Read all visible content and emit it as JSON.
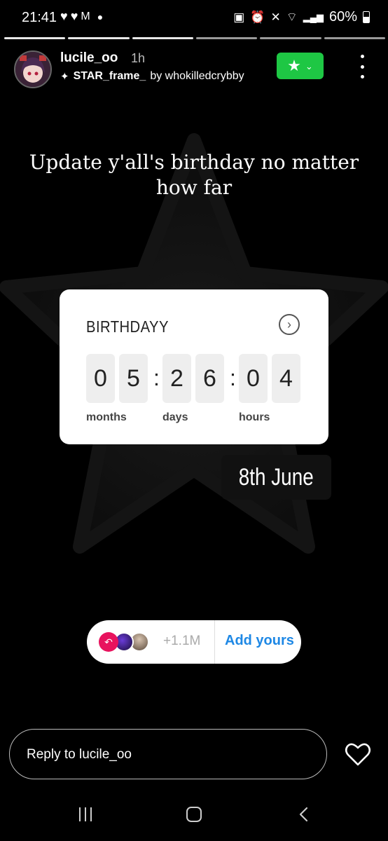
{
  "status_bar": {
    "time": "21:41",
    "left_icons": [
      "heart-icon",
      "heart-icon",
      "gmail-icon",
      "dot-icon"
    ],
    "right_icons": [
      "battery-saver-icon",
      "alarm-icon",
      "mute-icon",
      "wifi-icon",
      "signal-icon"
    ],
    "battery": "60%"
  },
  "story": {
    "progress_segments": 6,
    "progress_done": 3,
    "username": "lucile_oo",
    "time_ago": "1h",
    "frame_name": "STAR_frame_",
    "frame_by": "by whokilledcrybby",
    "star_button": "★",
    "caption": "Update y'all's birthday no matter how far"
  },
  "countdown": {
    "title": "BIRTHDAYY",
    "digits": [
      "0",
      "5",
      "2",
      "6",
      "0",
      "4"
    ],
    "units": [
      "months",
      "days",
      "hours"
    ]
  },
  "date_label": "8th June",
  "add_yours": {
    "count": "+1.1M",
    "button": "Add yours"
  },
  "reply": {
    "placeholder": "Reply to lucile_oo"
  },
  "colors": {
    "star_button": "#1ec744",
    "add_yours": "#1e88e5",
    "reply_badge": "#e8135e"
  }
}
